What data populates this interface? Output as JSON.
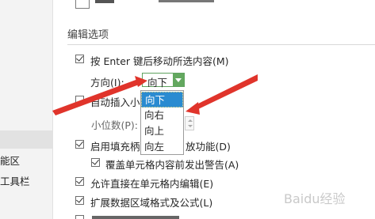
{
  "sidebar": {
    "items": [
      {
        "label": "能区",
        "selected": false
      },
      {
        "label": "工具栏",
        "selected": false
      }
    ]
  },
  "section": {
    "title": "编辑选项"
  },
  "options": {
    "move_after_enter": {
      "label": "按 Enter 键后移动所选内容(M)",
      "checked": true
    },
    "direction": {
      "label": "方向(I):",
      "selected": "向下"
    },
    "auto_decimal": {
      "label": "自动插入小",
      "checked": false
    },
    "decimal_places": {
      "label": "小位数(P):"
    },
    "fill_handle": {
      "label_start": "启用填充柄",
      "label_end": "放功能(D)",
      "checked": true
    },
    "overwrite_warning": {
      "label": "覆盖单元格内容前发出警告(A)",
      "checked": true
    },
    "edit_in_cell": {
      "label": "允许直接在单元格内编辑(E)",
      "checked": true
    },
    "extend_formats": {
      "label": "扩展数据区域格式及公式(L)",
      "checked": true
    }
  },
  "dropdown": {
    "options": [
      "向下",
      "向右",
      "向上",
      "向左"
    ],
    "selected_index": 0
  },
  "watermark": {
    "text": "Baidu经验"
  },
  "colors": {
    "dropdown_highlight": "#2a8bd1",
    "combo_accent": "#63a85f",
    "arrow": "#e0342b"
  }
}
